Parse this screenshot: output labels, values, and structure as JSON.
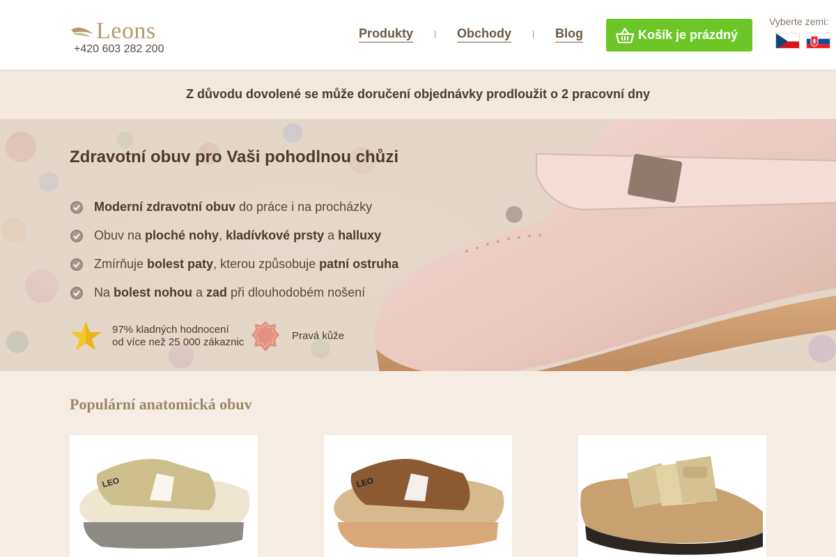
{
  "header": {
    "logo_text": "Leons",
    "phone": "+420 603 282 200",
    "nav": [
      {
        "label": "Produkty"
      },
      {
        "label": "Obchody"
      },
      {
        "label": "Blog"
      }
    ],
    "cart_label": "Košík je prázdný",
    "cart_icon": "basket-icon",
    "country_label": "Vyberte zemi:",
    "flags": [
      {
        "name": "czech-flag-icon"
      },
      {
        "name": "slovak-flag-icon"
      }
    ]
  },
  "notice": "Z důvodu dovolené se může doručení objednávky prodloužit o 2 pracovní dny",
  "hero": {
    "title": "Zdravotní obuv pro Vaši pohodlnou chůzi",
    "features": [
      {
        "b1": "Moderní zdravotní obuv",
        "t1": " do práce i na procházky"
      },
      {
        "t0": "Obuv na ",
        "b1": "ploché nohy",
        "t1": ", ",
        "b2": "kladívkové prsty",
        "t2": " a ",
        "b3": "halluxy"
      },
      {
        "t0": "Zmírňuje ",
        "b1": "bolest paty",
        "t1": ", kterou způsobuje ",
        "b2": "patní ostruha"
      },
      {
        "t0": "Na ",
        "b1": "bolest nohou",
        "t1": " a ",
        "b2": "zad",
        "t2": " při dlouhodobém nošení"
      }
    ],
    "rating_line1": "97% kladných hodnocení",
    "rating_line2": "od více než 25 000 zákaznic",
    "leather_label": "Pravá kůže"
  },
  "popular": {
    "title": "Populární anatomická obuv",
    "products": [
      {
        "icon": "gold-wedge-slide-icon"
      },
      {
        "icon": "brown-wedge-slide-icon"
      },
      {
        "icon": "gold-strap-sandal-icon"
      }
    ]
  },
  "colors": {
    "accent_green": "#6cc627",
    "brand_gold": "#b39a6e",
    "text_brown": "#4d3b2a"
  }
}
